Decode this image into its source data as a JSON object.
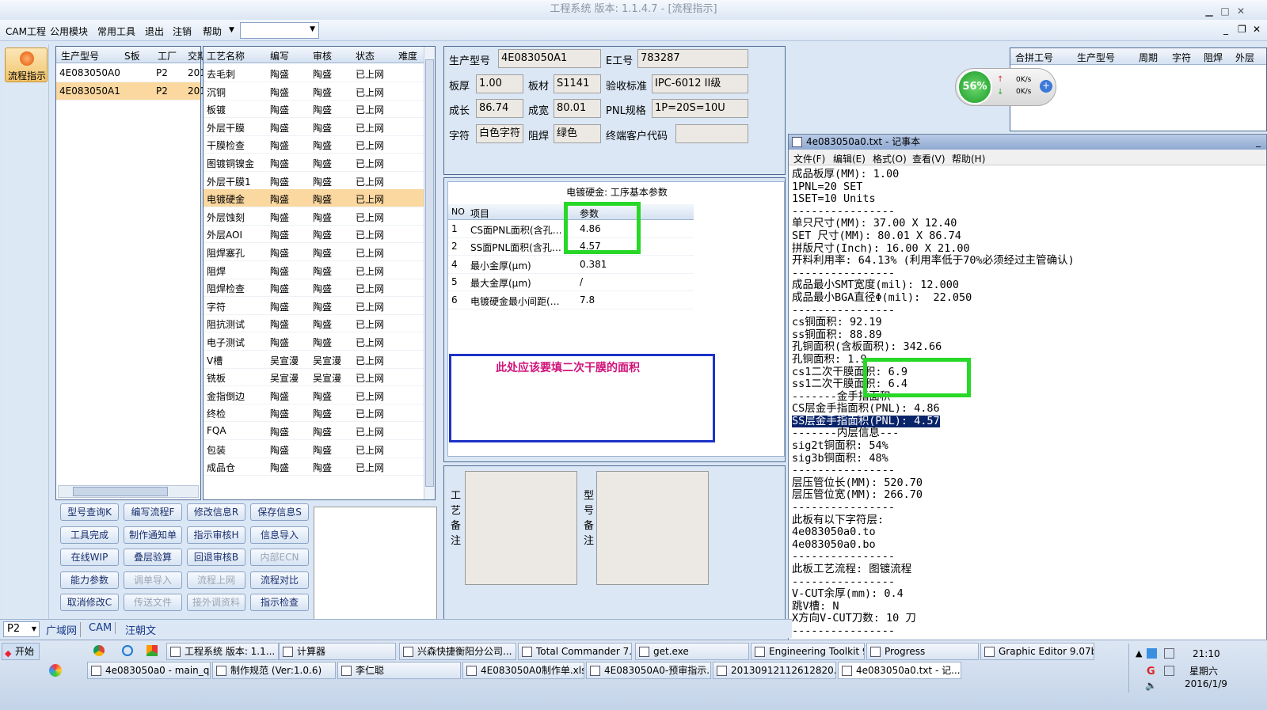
{
  "window": {
    "title": "工程系统 版本: 1.1.4.7 - [流程指示]"
  },
  "menu": [
    "CAM工程",
    "公用模块",
    "常用工具",
    "退出",
    "注销",
    "帮助"
  ],
  "left_strip": {
    "flow_label": "流程指示"
  },
  "model_table": {
    "headers": [
      "生产型号",
      "S板",
      "工厂",
      "交期"
    ],
    "rows": [
      [
        "4E083050A0",
        "",
        "P2",
        "201"
      ],
      [
        "4E083050A1",
        "",
        "P2",
        "201"
      ]
    ]
  },
  "process_table": {
    "headers": [
      "工艺名称",
      "编写",
      "审核",
      "状态",
      "难度"
    ],
    "rows": [
      [
        "去毛刺",
        "陶盛",
        "陶盛",
        "已上网"
      ],
      [
        "沉铜",
        "陶盛",
        "陶盛",
        "已上网"
      ],
      [
        "板镀",
        "陶盛",
        "陶盛",
        "已上网"
      ],
      [
        "外层干膜",
        "陶盛",
        "陶盛",
        "已上网"
      ],
      [
        "干膜检查",
        "陶盛",
        "陶盛",
        "已上网"
      ],
      [
        "图镀铜镍金",
        "陶盛",
        "陶盛",
        "已上网"
      ],
      [
        "外层干膜1",
        "陶盛",
        "陶盛",
        "已上网"
      ],
      [
        "电镀硬金",
        "陶盛",
        "陶盛",
        "已上网"
      ],
      [
        "外层蚀刻",
        "陶盛",
        "陶盛",
        "已上网"
      ],
      [
        "外层AOI",
        "陶盛",
        "陶盛",
        "已上网"
      ],
      [
        "阻焊塞孔",
        "陶盛",
        "陶盛",
        "已上网"
      ],
      [
        "阻焊",
        "陶盛",
        "陶盛",
        "已上网"
      ],
      [
        "阻焊检查",
        "陶盛",
        "陶盛",
        "已上网"
      ],
      [
        "字符",
        "陶盛",
        "陶盛",
        "已上网"
      ],
      [
        "阻抗测试",
        "陶盛",
        "陶盛",
        "已上网"
      ],
      [
        "电子测试",
        "陶盛",
        "陶盛",
        "已上网"
      ],
      [
        "V槽",
        "吴宣漫",
        "吴宣漫",
        "已上网"
      ],
      [
        "铣板",
        "吴宣漫",
        "吴宣漫",
        "已上网"
      ],
      [
        "金指倒边",
        "陶盛",
        "陶盛",
        "已上网"
      ],
      [
        "终检",
        "陶盛",
        "陶盛",
        "已上网"
      ],
      [
        "FQA",
        "陶盛",
        "陶盛",
        "已上网"
      ],
      [
        "包装",
        "陶盛",
        "陶盛",
        "已上网"
      ],
      [
        "成品仓",
        "陶盛",
        "陶盛",
        "已上网"
      ]
    ]
  },
  "buttons": [
    [
      "型号查询K",
      "编写流程F",
      "修改信息R",
      "保存信息S"
    ],
    [
      "工具完成",
      "制作通知单",
      "指示审核H",
      "信息导入"
    ],
    [
      "在线WIP",
      "叠层验算",
      "回退审核B",
      "内部ECN"
    ],
    [
      "能力参数",
      "调单导入",
      "流程上网",
      "流程对比"
    ],
    [
      "取消修改C",
      "传送文件",
      "接外调资料",
      "指示检查"
    ]
  ],
  "disabled_buttons": [
    "内部ECN",
    "调单导入",
    "流程上网",
    "传送文件",
    "接外调资料"
  ],
  "info": {
    "prod_model_label": "生产型号",
    "prod_model": "4E083050A1",
    "eno_label": "E工号",
    "eno": "783287",
    "thick_label": "板厚",
    "thick": "1.00",
    "material_label": "板材",
    "material": "S1141",
    "std_label": "验收标准",
    "std": "IPC-6012 II级",
    "len_label": "成长",
    "len": "86.74",
    "wid_label": "成宽",
    "wid": "80.01",
    "pnl_label": "PNL规格",
    "pnl": "1P=20S=10U",
    "char_label": "字符",
    "char": "白色字符",
    "mask_label": "阻焊",
    "mask": "绿色",
    "cust_label": "终端客户代码",
    "cust": ""
  },
  "params": {
    "title": "电镀硬金: 工序基本参数",
    "headers": [
      "NO",
      "项目",
      "参数"
    ],
    "rows": [
      [
        "1",
        "CS面PNL面积(含孔…",
        "4.86"
      ],
      [
        "2",
        "SS面PNL面积(含孔…",
        "4.57"
      ],
      [
        "4",
        "最小金厚(μm)",
        "0.381"
      ],
      [
        "5",
        "最大金厚(μm)",
        "/"
      ],
      [
        "6",
        "电镀硬金最小间距(…",
        "7.8"
      ]
    ]
  },
  "annotation": "此处应该要填二次干膜的面积",
  "remarks": {
    "process": [
      "工",
      "艺",
      "备",
      "注"
    ],
    "model": [
      "型",
      "号",
      "备",
      "注"
    ]
  },
  "merge_table": {
    "headers": [
      "合拼工号",
      "生产型号",
      "周期",
      "字符",
      "阻焊",
      "外层"
    ]
  },
  "speed_widget": {
    "percent": "56%",
    "up": "0K/s",
    "down": "0K/s"
  },
  "notepad": {
    "title": "4e083050a0.txt - 记事本",
    "menu": [
      "文件(F)",
      "编辑(E)",
      "格式(O)",
      "查看(V)",
      "帮助(H)"
    ],
    "lines": [
      "成品板厚(MM): 1.00",
      "1PNL=20 SET",
      "1SET=10 Units",
      "----------------",
      "单只尺寸(MM): 37.00 X 12.40",
      "SET 尺寸(MM): 80.01 X 86.74",
      "拼版尺寸(Inch): 16.00 X 21.00",
      "开料利用率: 64.13% (利用率低于70%必须经过主管确认)",
      "----------------",
      "成品最小SMT宽度(mil): 12.000",
      "成品最小BGA直径Φ(mil):  22.050",
      "----------------",
      "cs铜面积: 92.19",
      "ss铜面积: 88.89",
      "孔铜面积(含板面积): 342.66",
      "孔铜面积: 1.9",
      "cs1二次干膜面积: 6.9",
      "ss1二次干膜面积: 6.4",
      "-------金手指面积",
      "CS层金手指面积(PNL): 4.86",
      "SS层金手指面积(PNL): 4.57",
      "-------内层信息---",
      "sig2t铜面积: 54%",
      "sig3b铜面积: 48%",
      "----------------",
      "层压管位长(MM): 520.70",
      "层压管位宽(MM): 266.70",
      "----------------",
      "此板有以下字符层:",
      "4e083050a0.to",
      "4e083050a0.bo",
      "----------------",
      "此板工艺流程: 图镀流程",
      "----------------",
      "V-CUT余厚(mm): 0.4",
      "跳V槽: N",
      "X方向V-CUT刀数: 10 刀",
      "----------------"
    ]
  },
  "status": {
    "plant": "P2",
    "tabs": [
      "广域网",
      "CAM",
      "汪朝文"
    ]
  },
  "taskbar": {
    "start": "开始",
    "row1": [
      "工程系统 版本: 1.1...",
      "计算器",
      "兴森快捷衡阳分公司...",
      "Total Commander 7.0 ...",
      "get.exe",
      "Engineering Toolkit 9....",
      "Progress",
      "Graphic Editor 9.07b2 ..."
    ],
    "row2": [
      "4e083050a0 - main_qa",
      "制作规范 (Ver:1.0.6)",
      "李仁聪",
      "4E083050A0制作单.xls ...",
      "4E083050A0-预审指示...",
      "20130912112612820.rtf...",
      "4e083050a0.txt - 记..."
    ],
    "time": "21:10",
    "weekday": "星期六",
    "date": "2016/1/9"
  }
}
